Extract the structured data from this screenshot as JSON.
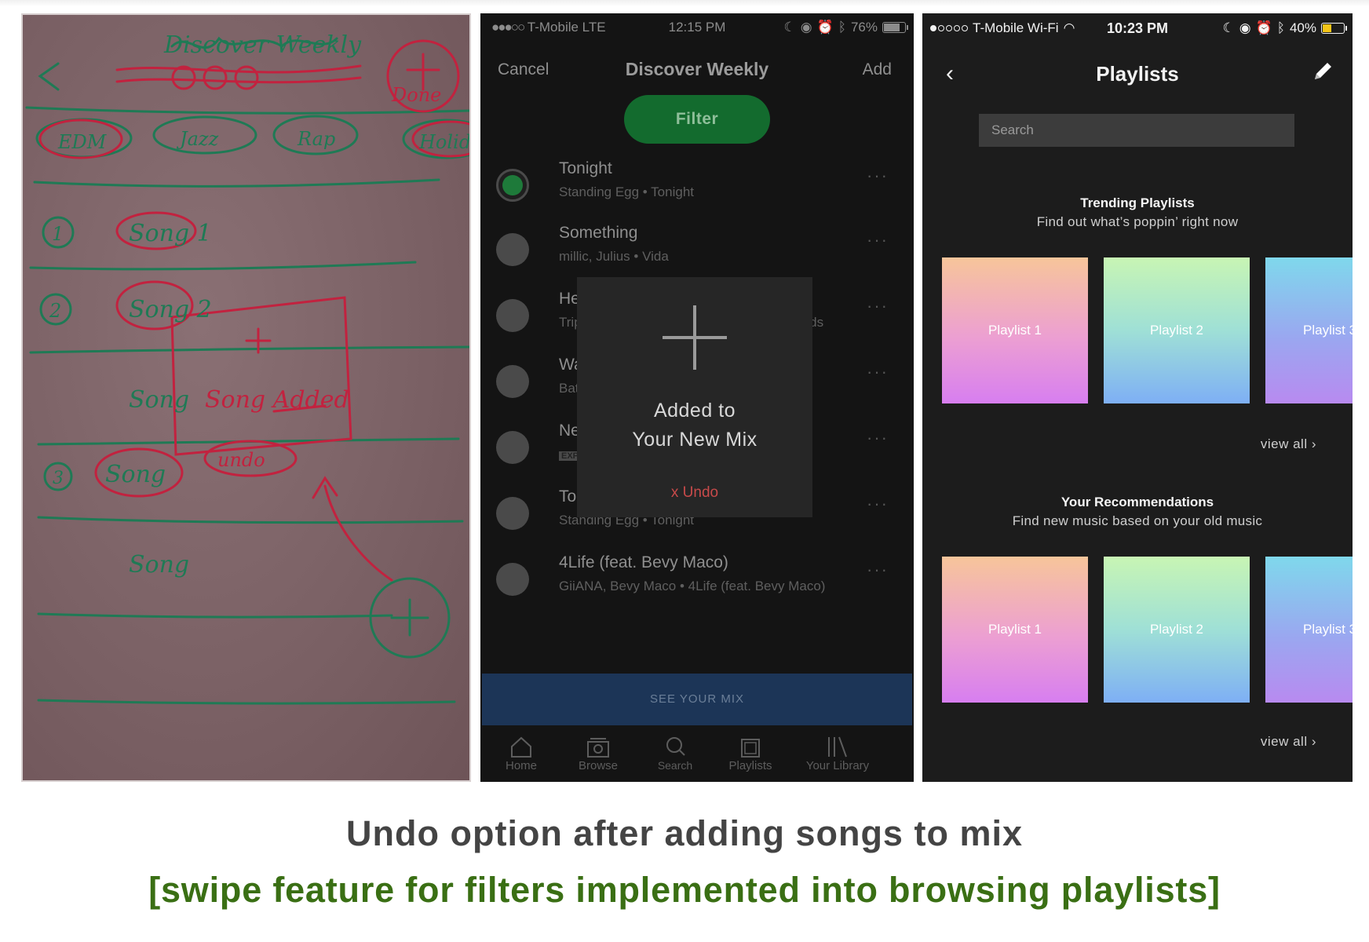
{
  "captions": {
    "main": "Undo option after adding songs to mix",
    "sub": "[swipe feature for filters implemented into browsing playlists]"
  },
  "sketch": {
    "title": "Discover Weekly",
    "filters": [
      "EDM",
      "Jazz",
      "Rap",
      "Holiday"
    ],
    "numbers": [
      "1",
      "2",
      "3"
    ],
    "songs": [
      "Song 1",
      "Song 2",
      "Song",
      "Song",
      "Song"
    ],
    "added_note": "Song Added",
    "undo_note": "undo",
    "done_note": "Done"
  },
  "discover_phone": {
    "status": {
      "carrier": "T-Mobile  LTE",
      "time": "12:15 PM",
      "battery": "76%"
    },
    "nav": {
      "cancel": "Cancel",
      "title": "Discover Weekly",
      "add": "Add"
    },
    "filter_label": "Filter",
    "songs": [
      {
        "name": "Tonight",
        "sub": "Standing Egg • Tonight",
        "selected": true
      },
      {
        "name": "Something",
        "sub": "millic, Julius • Vida",
        "selected": false
      },
      {
        "name": "He",
        "sub": "Trip",
        "sub_right": "Hands",
        "selected": false
      },
      {
        "name": "Wa",
        "sub": "Bat",
        "selected": false
      },
      {
        "name": "Ne",
        "sub": "EXP",
        "selected": false
      },
      {
        "name": "Tonight",
        "sub": "Standing Egg • Tonight",
        "selected": false
      },
      {
        "name": "4Life (feat. Bevy Maco)",
        "sub": "GiiANA, Bevy Maco • 4Life (feat. Bevy Maco)",
        "selected": false
      }
    ],
    "more_glyph": "···",
    "toast": {
      "line1": "Added to",
      "line2": "Your New Mix",
      "undo": "x Undo"
    },
    "see_mix": "SEE YOUR MIX",
    "tabs": [
      "Home",
      "Browse",
      "Search",
      "Playlists",
      "Your Library"
    ]
  },
  "playlists_phone": {
    "status": {
      "carrier": "T-Mobile Wi-Fi",
      "time": "10:23 PM",
      "battery": "40%"
    },
    "nav": {
      "back": "‹",
      "title": "Playlists"
    },
    "search_placeholder": "Search",
    "trending": {
      "title": "Trending Playlists",
      "subtitle": "Find out what’s poppin’ right now",
      "tiles": [
        "Playlist 1",
        "Playlist 2",
        "Playlist 3"
      ],
      "view_all": "view all ›"
    },
    "recommendations": {
      "title": "Your Recommendations",
      "subtitle": "Find new music based on your old music",
      "tiles": [
        "Playlist 1",
        "Playlist 2",
        "Playlist 3"
      ],
      "view_all": "view all ›"
    }
  },
  "colors": {
    "caption_main": "#444444",
    "caption_sub": "#3a6f14",
    "spotify_green": "#136b2e",
    "undo_red": "#c84a4a",
    "see_mix_blue": "#1c3557"
  }
}
